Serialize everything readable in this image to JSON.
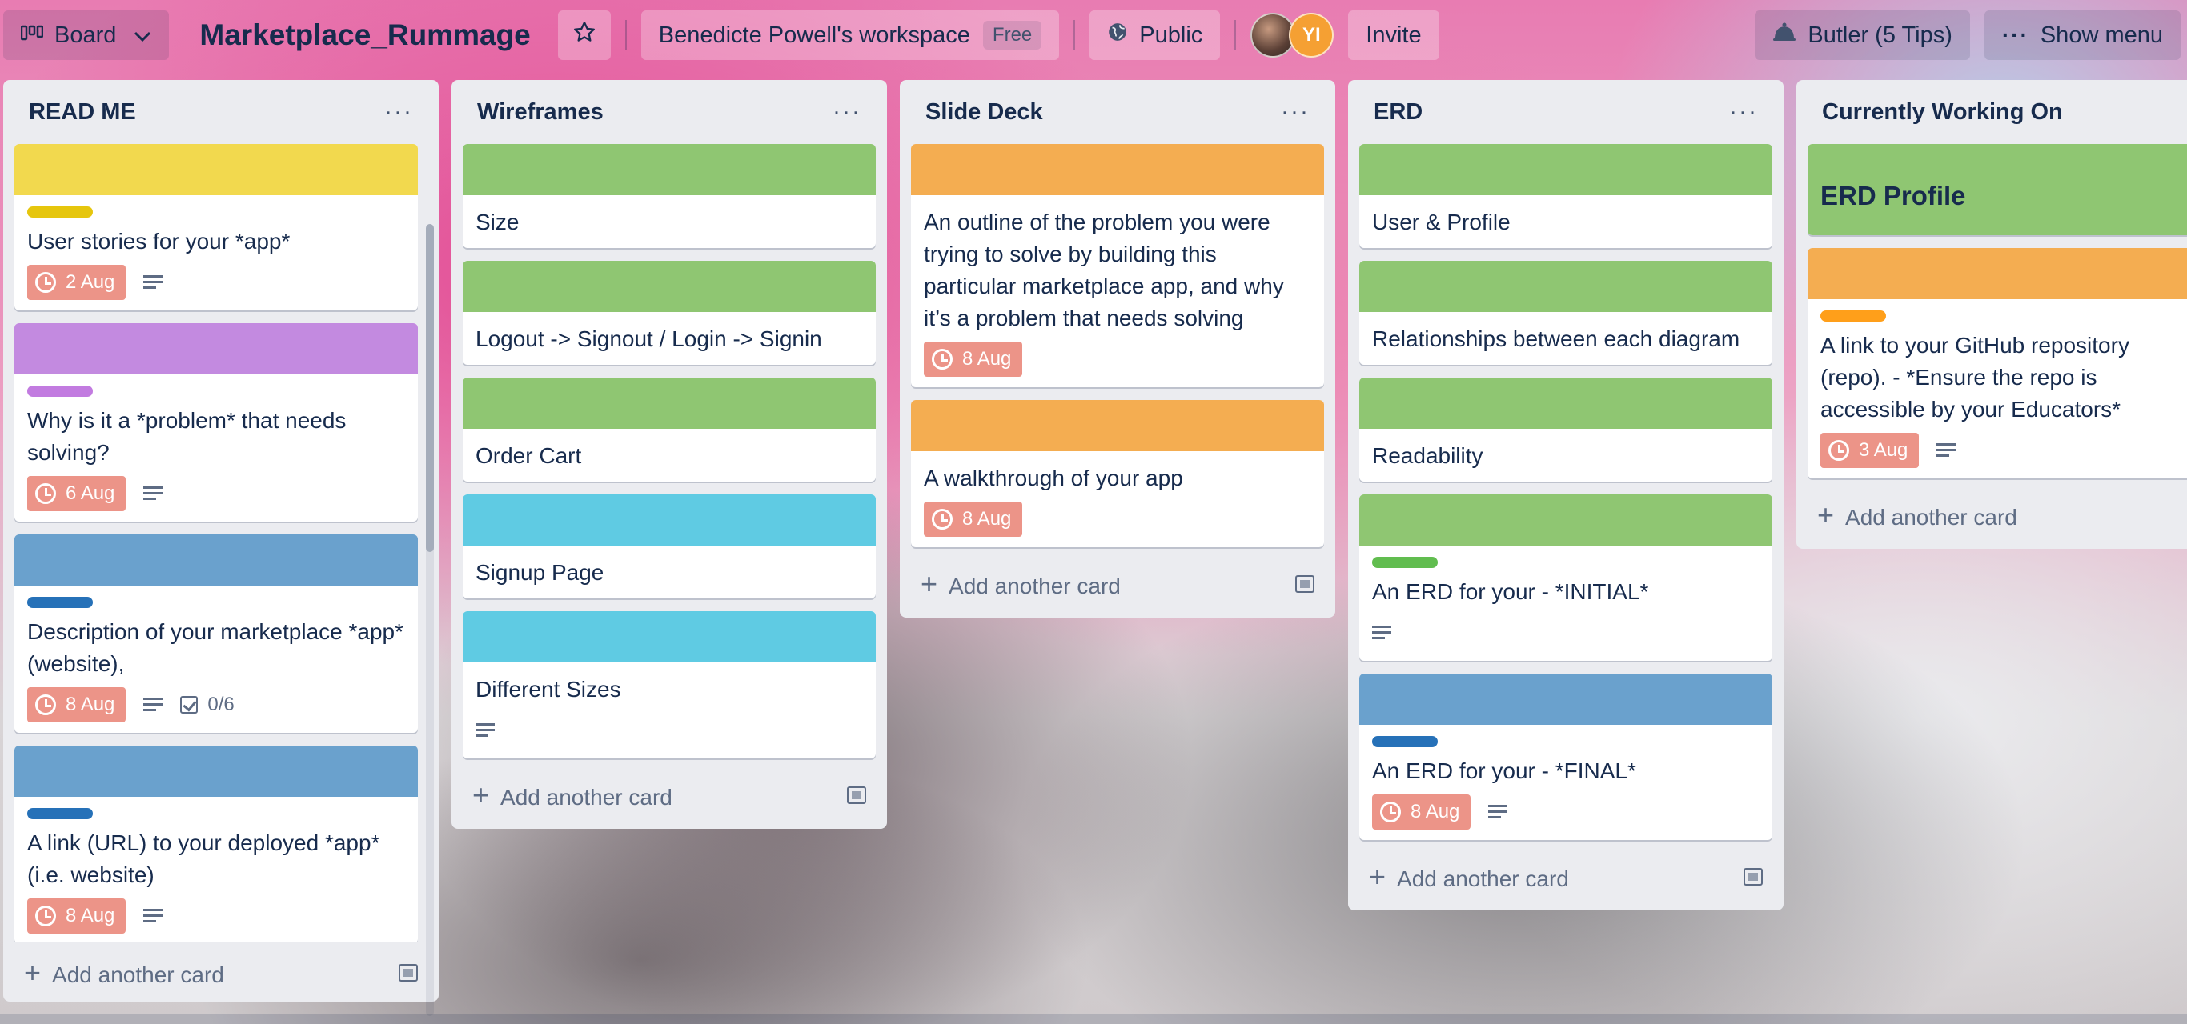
{
  "header": {
    "board_switcher": "Board",
    "board_title": "Marketplace_Rummage",
    "workspace": "Benedicte Powell's workspace",
    "workspace_plan": "Free",
    "visibility": "Public",
    "member_initials": "YI",
    "invite": "Invite",
    "butler": "Butler (5 Tips)",
    "show_menu": "Show menu"
  },
  "colors": {
    "green": "#8fc672",
    "yellow": "#f2d94e",
    "purple": "#c38ae0",
    "blue": "#6aa1cd",
    "sky": "#5fcbe3",
    "orange": "#f4ad51",
    "label_yellow": "#e6c60d",
    "label_purple": "#c27be0",
    "label_blue": "#2671b8",
    "label_green": "#61bd4f",
    "label_orange": "#ff9f1a",
    "due_bg": "#ec9488"
  },
  "add_card_label": "Add another card",
  "lists": [
    {
      "title": "READ ME",
      "cards": [
        {
          "title": "User stories for your *app*",
          "due": "2 Aug"
        },
        {
          "title": "Why is it a *problem* that needs solving?",
          "due": "6 Aug"
        },
        {
          "title": "Description of your marketplace *app* (website),",
          "due": "8 Aug",
          "checklist": "0/6"
        },
        {
          "title": "A link (URL) to your deployed *app* (i.e. website)",
          "due": "8 Aug"
        }
      ]
    },
    {
      "title": "Wireframes",
      "cards": [
        {
          "title": "Size"
        },
        {
          "title": "Logout -> Signout / Login -> Signin"
        },
        {
          "title": "Order Cart"
        },
        {
          "title": "Signup Page"
        },
        {
          "title": "Different Sizes"
        }
      ]
    },
    {
      "title": "Slide Deck",
      "cards": [
        {
          "title": "An outline of the problem you were trying to solve by building this particular marketplace app, and why it’s a problem that needs solving",
          "due": "8 Aug"
        },
        {
          "title": "A walkthrough of your app",
          "due": "8 Aug"
        }
      ]
    },
    {
      "title": "ERD",
      "cards": [
        {
          "title": "User & Profile"
        },
        {
          "title": "Relationships between each diagram"
        },
        {
          "title": "Readability"
        },
        {
          "title": "An ERD for your - *INITIAL*"
        },
        {
          "title": "An ERD for your - *FINAL*",
          "due": "8 Aug"
        }
      ]
    },
    {
      "title": "Currently Working On",
      "cards": [
        {
          "title": "ERD Profile"
        },
        {
          "title": "A link to your GitHub repository (repo). - *Ensure the repo is accessible by your Educators*",
          "due": "3 Aug"
        }
      ]
    }
  ]
}
